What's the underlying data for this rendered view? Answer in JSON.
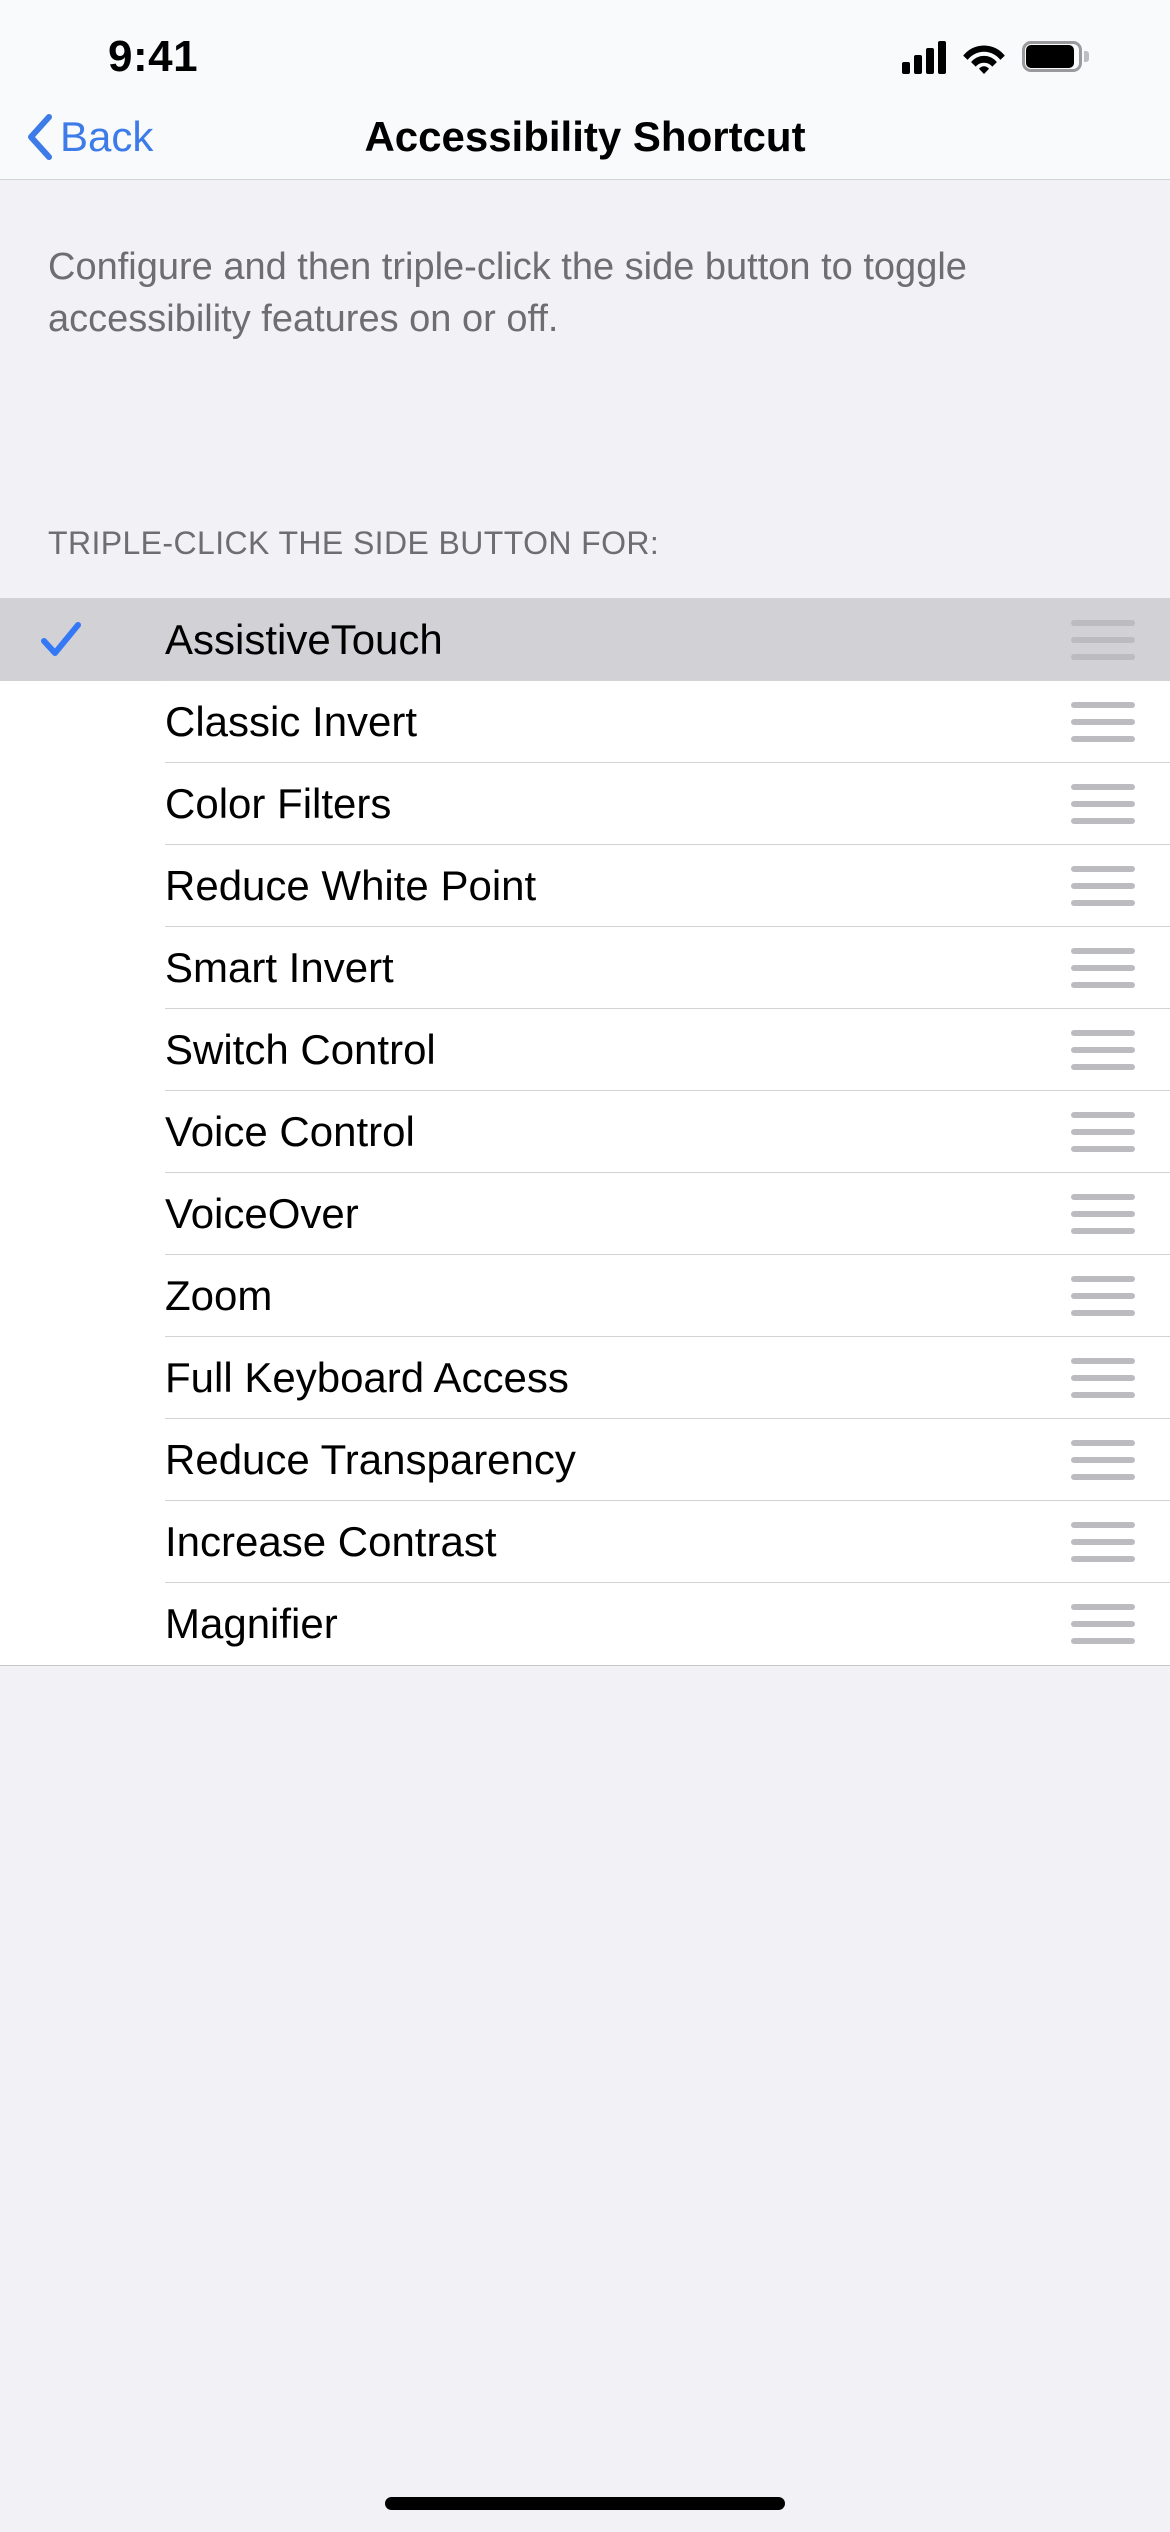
{
  "status_bar": {
    "time": "9:41",
    "cellular_icon": "signal-bars-icon",
    "wifi_icon": "wifi-icon",
    "battery_icon": "battery-icon"
  },
  "nav": {
    "back_label": "Back",
    "back_icon": "chevron-left-icon",
    "title": "Accessibility Shortcut"
  },
  "description": {
    "text": "Configure and then triple-click the side button to toggle accessibility features on or off."
  },
  "section": {
    "header": "TRIPLE-CLICK THE SIDE BUTTON FOR:"
  },
  "colors": {
    "accent_blue": "#3C7BE8",
    "checkmark_blue": "#3478F6",
    "selected_row_bg": "#D1D1D6",
    "page_bg": "#F2F1F6",
    "list_bg": "#FFFFFF",
    "separator": "#D3D3D6",
    "secondary_text": "#6D6D72",
    "drag_handle": "#BCBCC0"
  },
  "list": {
    "rows": [
      {
        "label": "AssistiveTouch",
        "selected": true,
        "check_icon": "checkmark-icon",
        "drag_icon": "drag-handle-icon"
      },
      {
        "label": "Classic Invert",
        "selected": false,
        "check_icon": "",
        "drag_icon": "drag-handle-icon"
      },
      {
        "label": "Color Filters",
        "selected": false,
        "check_icon": "",
        "drag_icon": "drag-handle-icon"
      },
      {
        "label": "Reduce White Point",
        "selected": false,
        "check_icon": "",
        "drag_icon": "drag-handle-icon"
      },
      {
        "label": "Smart Invert",
        "selected": false,
        "check_icon": "",
        "drag_icon": "drag-handle-icon"
      },
      {
        "label": "Switch Control",
        "selected": false,
        "check_icon": "",
        "drag_icon": "drag-handle-icon"
      },
      {
        "label": "Voice Control",
        "selected": false,
        "check_icon": "",
        "drag_icon": "drag-handle-icon"
      },
      {
        "label": "VoiceOver",
        "selected": false,
        "check_icon": "",
        "drag_icon": "drag-handle-icon"
      },
      {
        "label": "Zoom",
        "selected": false,
        "check_icon": "",
        "drag_icon": "drag-handle-icon"
      },
      {
        "label": "Full Keyboard Access",
        "selected": false,
        "check_icon": "",
        "drag_icon": "drag-handle-icon"
      },
      {
        "label": "Reduce Transparency",
        "selected": false,
        "check_icon": "",
        "drag_icon": "drag-handle-icon"
      },
      {
        "label": "Increase Contrast",
        "selected": false,
        "check_icon": "",
        "drag_icon": "drag-handle-icon"
      },
      {
        "label": "Magnifier",
        "selected": false,
        "check_icon": "",
        "drag_icon": "drag-handle-icon"
      }
    ]
  },
  "home_indicator": {
    "name": "home-indicator"
  }
}
